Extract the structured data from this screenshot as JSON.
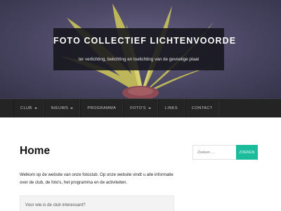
{
  "site": {
    "title": "FOTO COLLECTIEF LICHTENVOORDE",
    "tagline": "ter verlichting, belichting en toelichting van de gevoelige plaat"
  },
  "nav": {
    "items": [
      {
        "label": "CLUB",
        "dropdown": true
      },
      {
        "label": "NIEUWS",
        "dropdown": true
      },
      {
        "label": "PROGRAMMA",
        "dropdown": false
      },
      {
        "label": "FOTO'S",
        "dropdown": true
      },
      {
        "label": "LINKS",
        "dropdown": false
      },
      {
        "label": "CONTACT",
        "dropdown": false
      }
    ]
  },
  "main": {
    "heading": "Home",
    "intro": "Welkom op de website van onze fotoclub. Op onze website vindt u alle informatie over de club, de foto's, het programma en de activiteiten.",
    "faq_question": "Voor wie is de club interessant?"
  },
  "search": {
    "placeholder": "Zoeken …",
    "button_label": "ZOEKEN"
  },
  "colors": {
    "accent": "#1abc9c",
    "navbar": "#242424",
    "hero_bg": "#4e4a68"
  },
  "icons": {
    "caret": "chevron-down-icon"
  }
}
